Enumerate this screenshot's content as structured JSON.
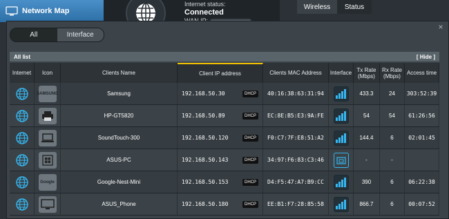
{
  "background": {
    "sidebar": {
      "network_map_label": "Network Map"
    },
    "status": {
      "internet_status_label": "Internet status:",
      "internet_status_value": "Connected",
      "wan_ip_label": "WAN IP:"
    },
    "tabs": [
      {
        "label": "Wireless"
      },
      {
        "label": "Status"
      }
    ]
  },
  "modal": {
    "filter": {
      "all": "All",
      "interface": "Interface"
    },
    "close_glyph": "×",
    "list_title": "All list",
    "hide_label": "[ Hide ]",
    "columns": {
      "internet": "Internet",
      "icon": "Icon",
      "name": "Clients Name",
      "ip": "Client IP address",
      "mac": "Clients MAC Address",
      "interface": "Interface",
      "tx": "Tx Rate (Mbps)",
      "rx": "Rx Rate (Mbps)",
      "access": "Access time"
    },
    "clients": [
      {
        "name": "Samsung",
        "device_icon": "samsung-tv-icon",
        "device_text": "SAMSUNG",
        "ip": "192.168.50.30",
        "ip_type": "DHCP",
        "mac": "40:16:38:63:31:94",
        "interface": "wifi-5ghz",
        "tx": "433.3",
        "rx": "24",
        "access": "303:52:39"
      },
      {
        "name": "HP-GT5820",
        "device_icon": "printer-icon",
        "device_text": "",
        "ip": "192.168.50.89",
        "ip_type": "DHCP",
        "mac": "EC:8E:B5:E3:9A:FE",
        "interface": "wifi-2.4ghz",
        "tx": "54",
        "rx": "54",
        "access": "61:26:56"
      },
      {
        "name": "SoundTouch-300",
        "device_icon": "laptop-icon",
        "device_text": "",
        "ip": "192.168.50.120",
        "ip_type": "DHCP",
        "mac": "F0:C7:7F:E8:51:A2",
        "interface": "wifi-2.4ghz",
        "tx": "144.4",
        "rx": "6",
        "access": "02:01:45"
      },
      {
        "name": "ASUS-PC",
        "device_icon": "windows-device-icon",
        "device_text": "",
        "ip": "192.168.50.143",
        "ip_type": "DHCP",
        "mac": "34:97:F6:83:C3:46",
        "interface": "ethernet",
        "tx": "-",
        "rx": "-",
        "access": ""
      },
      {
        "name": "Google-Nest-Mini",
        "device_icon": "google-icon",
        "device_text": "Google",
        "ip": "192.168.50.153",
        "ip_type": "DHCP",
        "mac": "D4:F5:47:A7:B9:CC",
        "interface": "wifi-5ghz",
        "tx": "390",
        "rx": "6",
        "access": "06:22:38"
      },
      {
        "name": "ASUS_Phone",
        "device_icon": "monitor-icon",
        "device_text": "",
        "ip": "192.168.50.180",
        "ip_type": "DHCP",
        "mac": "EE:B1:F7:28:85:58",
        "interface": "wifi-5ghz",
        "tx": "866.7",
        "rx": "6",
        "access": "00:07:52"
      }
    ]
  },
  "colors": {
    "accent": "#37b7f1",
    "selected_column": "#f2c200",
    "header_blue": "#2d6ea6"
  }
}
